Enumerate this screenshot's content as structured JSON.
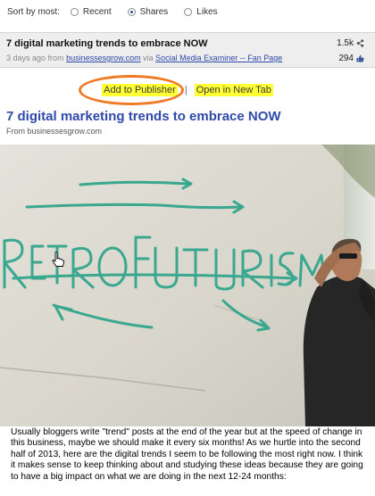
{
  "sort": {
    "label": "Sort by most:",
    "options": [
      {
        "label": "Recent",
        "selected": false
      },
      {
        "label": "Shares",
        "selected": true
      },
      {
        "label": "Likes",
        "selected": false
      }
    ]
  },
  "item": {
    "title": "7 digital marketing trends to embrace NOW",
    "time": "3 days ago from",
    "source_link": "businessesgrow.com",
    "via_text": "via",
    "via_link": "Social Media Examiner -- Fan Page",
    "count_primary": "1.5k",
    "count_secondary": "294"
  },
  "actions": {
    "add": "Add to Publisher",
    "separator": "|",
    "open": "Open in New Tab"
  },
  "article": {
    "title": "7 digital marketing trends to embrace NOW",
    "source": "From businessesgrow.com",
    "image_text": "RetROfuTuRisM",
    "body": "Usually bloggers write \"trend\" posts at the end of the year but at the speed of change in this business, maybe we should make it every six months!  As we hurtle into the second half of 2013, here are the digital trends I seem to be following the most right now. I think it makes sense to keep thinking about and studying these ideas because they are going to have a big impact on what we are doing in the next 12-24 months:"
  },
  "colors": {
    "link": "#2f4aa8",
    "highlight": "#ffff33",
    "circle": "#f07a24",
    "graffiti": "#3aa78f"
  }
}
